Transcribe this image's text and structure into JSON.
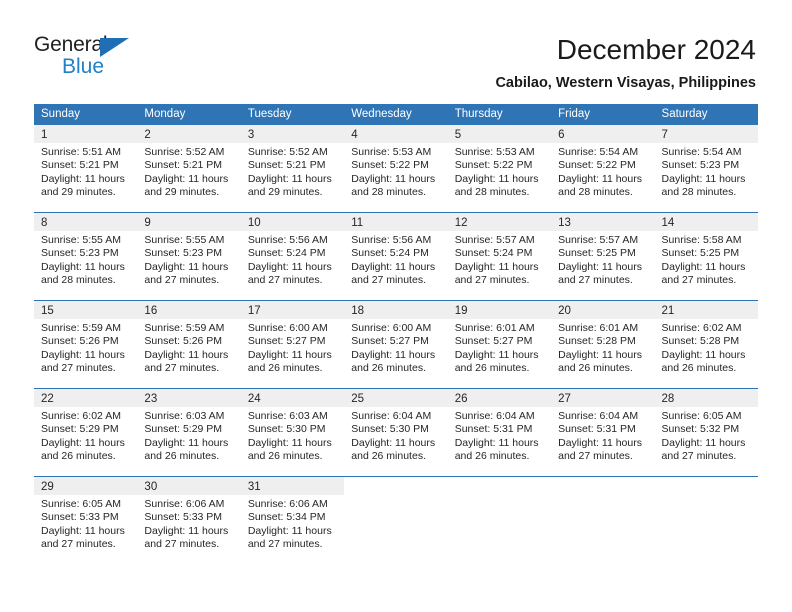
{
  "logo": {
    "word_one": "General",
    "word_two": "Blue",
    "triangle_icon": "blue-triangle-icon",
    "colors": {
      "dark": "#231f20",
      "blue": "#2080c8",
      "triangle": "#1f6fb5"
    }
  },
  "header": {
    "title": "December 2024",
    "subtitle": "Cabilao, Western Visayas, Philippines"
  },
  "theme": {
    "header_blue": "#2f74b5",
    "daynum_band": "#efefef",
    "text": "#262626",
    "white": "#ffffff"
  },
  "calendar": {
    "weekdays": [
      "Sunday",
      "Monday",
      "Tuesday",
      "Wednesday",
      "Thursday",
      "Friday",
      "Saturday"
    ],
    "weeks": [
      [
        {
          "day": "1",
          "sunrise": "Sunrise: 5:51 AM",
          "sunset": "Sunset: 5:21 PM",
          "daylight_1": "Daylight: 11 hours",
          "daylight_2": "and 29 minutes."
        },
        {
          "day": "2",
          "sunrise": "Sunrise: 5:52 AM",
          "sunset": "Sunset: 5:21 PM",
          "daylight_1": "Daylight: 11 hours",
          "daylight_2": "and 29 minutes."
        },
        {
          "day": "3",
          "sunrise": "Sunrise: 5:52 AM",
          "sunset": "Sunset: 5:21 PM",
          "daylight_1": "Daylight: 11 hours",
          "daylight_2": "and 29 minutes."
        },
        {
          "day": "4",
          "sunrise": "Sunrise: 5:53 AM",
          "sunset": "Sunset: 5:22 PM",
          "daylight_1": "Daylight: 11 hours",
          "daylight_2": "and 28 minutes."
        },
        {
          "day": "5",
          "sunrise": "Sunrise: 5:53 AM",
          "sunset": "Sunset: 5:22 PM",
          "daylight_1": "Daylight: 11 hours",
          "daylight_2": "and 28 minutes."
        },
        {
          "day": "6",
          "sunrise": "Sunrise: 5:54 AM",
          "sunset": "Sunset: 5:22 PM",
          "daylight_1": "Daylight: 11 hours",
          "daylight_2": "and 28 minutes."
        },
        {
          "day": "7",
          "sunrise": "Sunrise: 5:54 AM",
          "sunset": "Sunset: 5:23 PM",
          "daylight_1": "Daylight: 11 hours",
          "daylight_2": "and 28 minutes."
        }
      ],
      [
        {
          "day": "8",
          "sunrise": "Sunrise: 5:55 AM",
          "sunset": "Sunset: 5:23 PM",
          "daylight_1": "Daylight: 11 hours",
          "daylight_2": "and 28 minutes."
        },
        {
          "day": "9",
          "sunrise": "Sunrise: 5:55 AM",
          "sunset": "Sunset: 5:23 PM",
          "daylight_1": "Daylight: 11 hours",
          "daylight_2": "and 27 minutes."
        },
        {
          "day": "10",
          "sunrise": "Sunrise: 5:56 AM",
          "sunset": "Sunset: 5:24 PM",
          "daylight_1": "Daylight: 11 hours",
          "daylight_2": "and 27 minutes."
        },
        {
          "day": "11",
          "sunrise": "Sunrise: 5:56 AM",
          "sunset": "Sunset: 5:24 PM",
          "daylight_1": "Daylight: 11 hours",
          "daylight_2": "and 27 minutes."
        },
        {
          "day": "12",
          "sunrise": "Sunrise: 5:57 AM",
          "sunset": "Sunset: 5:24 PM",
          "daylight_1": "Daylight: 11 hours",
          "daylight_2": "and 27 minutes."
        },
        {
          "day": "13",
          "sunrise": "Sunrise: 5:57 AM",
          "sunset": "Sunset: 5:25 PM",
          "daylight_1": "Daylight: 11 hours",
          "daylight_2": "and 27 minutes."
        },
        {
          "day": "14",
          "sunrise": "Sunrise: 5:58 AM",
          "sunset": "Sunset: 5:25 PM",
          "daylight_1": "Daylight: 11 hours",
          "daylight_2": "and 27 minutes."
        }
      ],
      [
        {
          "day": "15",
          "sunrise": "Sunrise: 5:59 AM",
          "sunset": "Sunset: 5:26 PM",
          "daylight_1": "Daylight: 11 hours",
          "daylight_2": "and 27 minutes."
        },
        {
          "day": "16",
          "sunrise": "Sunrise: 5:59 AM",
          "sunset": "Sunset: 5:26 PM",
          "daylight_1": "Daylight: 11 hours",
          "daylight_2": "and 27 minutes."
        },
        {
          "day": "17",
          "sunrise": "Sunrise: 6:00 AM",
          "sunset": "Sunset: 5:27 PM",
          "daylight_1": "Daylight: 11 hours",
          "daylight_2": "and 26 minutes."
        },
        {
          "day": "18",
          "sunrise": "Sunrise: 6:00 AM",
          "sunset": "Sunset: 5:27 PM",
          "daylight_1": "Daylight: 11 hours",
          "daylight_2": "and 26 minutes."
        },
        {
          "day": "19",
          "sunrise": "Sunrise: 6:01 AM",
          "sunset": "Sunset: 5:27 PM",
          "daylight_1": "Daylight: 11 hours",
          "daylight_2": "and 26 minutes."
        },
        {
          "day": "20",
          "sunrise": "Sunrise: 6:01 AM",
          "sunset": "Sunset: 5:28 PM",
          "daylight_1": "Daylight: 11 hours",
          "daylight_2": "and 26 minutes."
        },
        {
          "day": "21",
          "sunrise": "Sunrise: 6:02 AM",
          "sunset": "Sunset: 5:28 PM",
          "daylight_1": "Daylight: 11 hours",
          "daylight_2": "and 26 minutes."
        }
      ],
      [
        {
          "day": "22",
          "sunrise": "Sunrise: 6:02 AM",
          "sunset": "Sunset: 5:29 PM",
          "daylight_1": "Daylight: 11 hours",
          "daylight_2": "and 26 minutes."
        },
        {
          "day": "23",
          "sunrise": "Sunrise: 6:03 AM",
          "sunset": "Sunset: 5:29 PM",
          "daylight_1": "Daylight: 11 hours",
          "daylight_2": "and 26 minutes."
        },
        {
          "day": "24",
          "sunrise": "Sunrise: 6:03 AM",
          "sunset": "Sunset: 5:30 PM",
          "daylight_1": "Daylight: 11 hours",
          "daylight_2": "and 26 minutes."
        },
        {
          "day": "25",
          "sunrise": "Sunrise: 6:04 AM",
          "sunset": "Sunset: 5:30 PM",
          "daylight_1": "Daylight: 11 hours",
          "daylight_2": "and 26 minutes."
        },
        {
          "day": "26",
          "sunrise": "Sunrise: 6:04 AM",
          "sunset": "Sunset: 5:31 PM",
          "daylight_1": "Daylight: 11 hours",
          "daylight_2": "and 26 minutes."
        },
        {
          "day": "27",
          "sunrise": "Sunrise: 6:04 AM",
          "sunset": "Sunset: 5:31 PM",
          "daylight_1": "Daylight: 11 hours",
          "daylight_2": "and 27 minutes."
        },
        {
          "day": "28",
          "sunrise": "Sunrise: 6:05 AM",
          "sunset": "Sunset: 5:32 PM",
          "daylight_1": "Daylight: 11 hours",
          "daylight_2": "and 27 minutes."
        }
      ],
      [
        {
          "day": "29",
          "sunrise": "Sunrise: 6:05 AM",
          "sunset": "Sunset: 5:33 PM",
          "daylight_1": "Daylight: 11 hours",
          "daylight_2": "and 27 minutes."
        },
        {
          "day": "30",
          "sunrise": "Sunrise: 6:06 AM",
          "sunset": "Sunset: 5:33 PM",
          "daylight_1": "Daylight: 11 hours",
          "daylight_2": "and 27 minutes."
        },
        {
          "day": "31",
          "sunrise": "Sunrise: 6:06 AM",
          "sunset": "Sunset: 5:34 PM",
          "daylight_1": "Daylight: 11 hours",
          "daylight_2": "and 27 minutes."
        },
        {
          "day": "",
          "sunrise": "",
          "sunset": "",
          "daylight_1": "",
          "daylight_2": ""
        },
        {
          "day": "",
          "sunrise": "",
          "sunset": "",
          "daylight_1": "",
          "daylight_2": ""
        },
        {
          "day": "",
          "sunrise": "",
          "sunset": "",
          "daylight_1": "",
          "daylight_2": ""
        },
        {
          "day": "",
          "sunrise": "",
          "sunset": "",
          "daylight_1": "",
          "daylight_2": ""
        }
      ]
    ]
  }
}
